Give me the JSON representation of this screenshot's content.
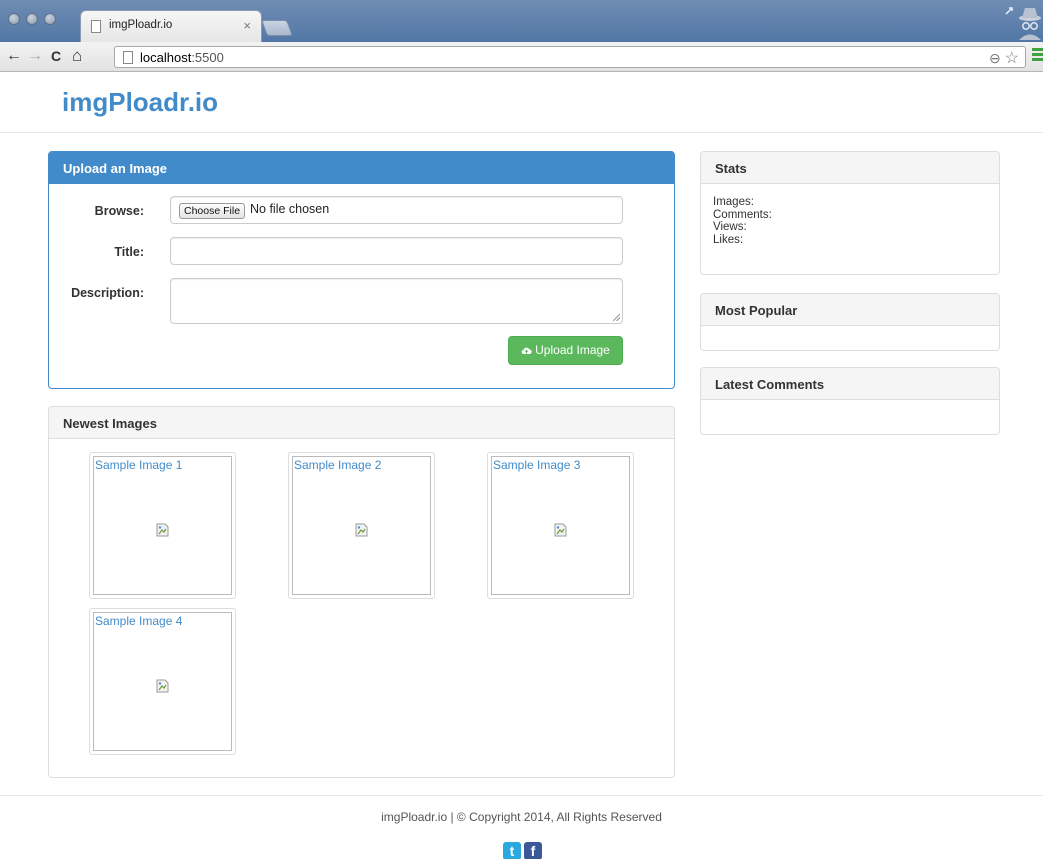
{
  "browser": {
    "tab_title": "imgPloadr.io",
    "tab_close": "×",
    "url_host": "localhost",
    "url_port": ":5500",
    "nav_back": "←",
    "nav_forward": "→",
    "nav_reload": "C",
    "nav_home": "⌂",
    "zoom_icon": "⊖",
    "star_icon": "☆"
  },
  "header": {
    "brand": "imgPloadr.io"
  },
  "upload_panel": {
    "title": "Upload an Image",
    "browse_label": "Browse:",
    "choose_file": "Choose File",
    "no_file": "No file chosen",
    "title_label": "Title:",
    "title_value": "",
    "description_label": "Description:",
    "description_value": "",
    "upload_button": "Upload Image"
  },
  "newest_panel": {
    "title": "Newest Images",
    "images": [
      {
        "title": "Sample Image 1"
      },
      {
        "title": "Sample Image 2"
      },
      {
        "title": "Sample Image 3"
      },
      {
        "title": "Sample Image 4"
      }
    ]
  },
  "sidebar": {
    "stats": {
      "title": "Stats",
      "images": "Images:",
      "comments": "Comments:",
      "views": "Views:",
      "likes": "Likes:"
    },
    "most_popular": {
      "title": "Most Popular"
    },
    "latest_comments": {
      "title": "Latest Comments"
    }
  },
  "footer": {
    "text": "imgPloadr.io | © Copyright 2014, All Rights Reserved",
    "twitter_icon": "t",
    "facebook_icon": "f"
  },
  "colors": {
    "brand": "#428bca",
    "primary": "#428bca",
    "success": "#5cb85c",
    "twitter": "#2aa9e0",
    "facebook": "#3b5998"
  }
}
